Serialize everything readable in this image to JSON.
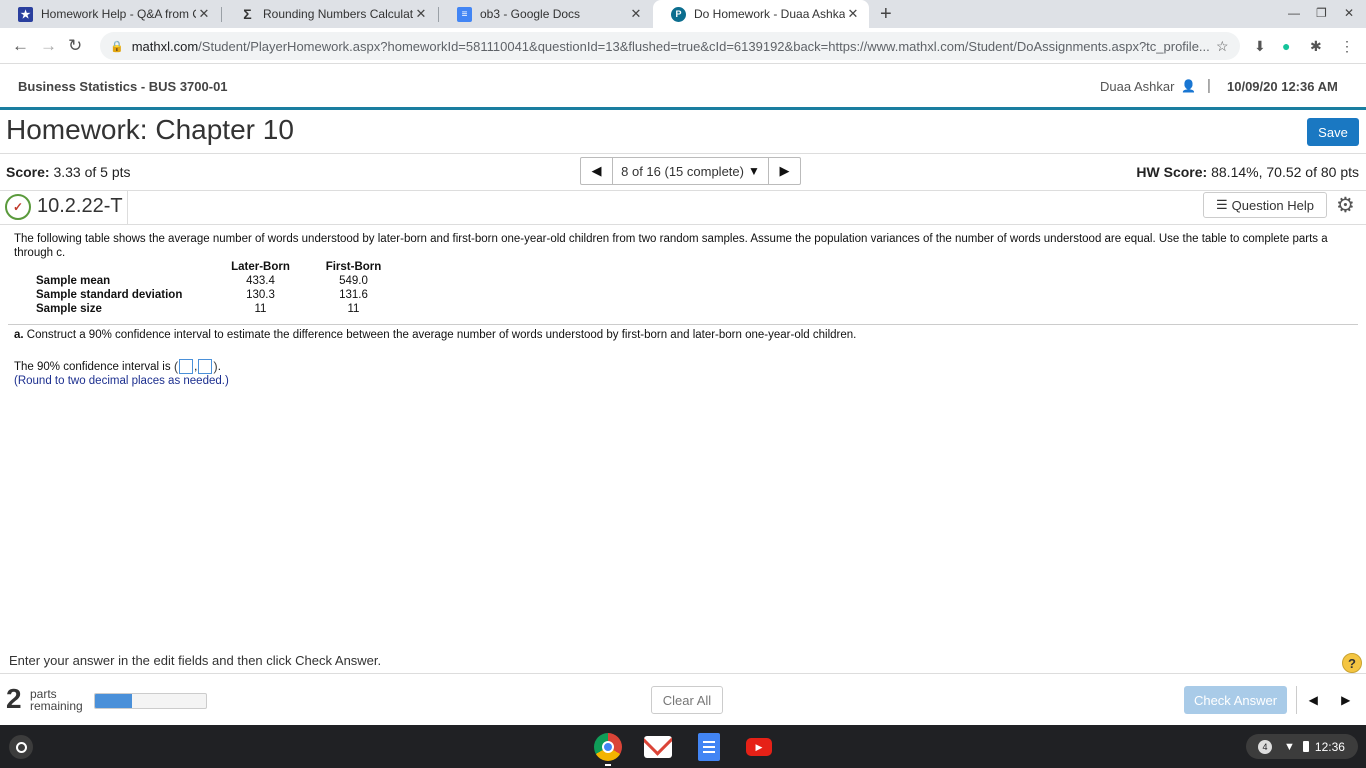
{
  "browser": {
    "tabs": [
      {
        "title": "Homework Help - Q&A from Onli",
        "icon": "star-shield-icon",
        "active": false
      },
      {
        "title": "Rounding Numbers Calculator",
        "icon": "sigma-icon",
        "active": false
      },
      {
        "title": "ob3 - Google Docs",
        "icon": "docs-icon",
        "active": false
      },
      {
        "title": "Do Homework - Duaa Ashkar",
        "icon": "pearson-icon",
        "active": true
      }
    ],
    "new_tab": "+",
    "url_host": "mathxl.com",
    "url_rest": "/Student/PlayerHomework.aspx?homeworkId=581110041&questionId=13&flushed=true&cId=6139192&back=https://www.mathxl.com/Student/DoAssignments.aspx?tc_profile..."
  },
  "header": {
    "course": "Business Statistics - BUS 3700-01",
    "user": "Duaa Ashkar",
    "separator": "|",
    "datetime": "10/09/20 12:36 AM"
  },
  "homework": {
    "title": "Homework: Chapter 10",
    "save_label": "Save",
    "score_label": "Score:",
    "score_value": "3.33 of 5 pts",
    "question_nav": "8 of 16 (15 complete)",
    "hw_score_label": "HW Score:",
    "hw_score_value": "88.14%, 70.52 of 80 pts",
    "question_id": "10.2.22-T",
    "question_help": "Question Help"
  },
  "question": {
    "text": "The following table shows the average number of words understood by later-born and first-born one-year-old children from two random samples. Assume the population variances of the number of words understood are equal. Use the table to complete parts a through c.",
    "table": {
      "columns": [
        "Later-Born",
        "First-Born"
      ],
      "rows": [
        {
          "label": "Sample mean",
          "values": [
            "433.4",
            "549.0"
          ]
        },
        {
          "label": "Sample standard deviation",
          "values": [
            "130.3",
            "131.6"
          ]
        },
        {
          "label": "Sample size",
          "values": [
            "11",
            "11"
          ]
        }
      ]
    },
    "part_a_label": "a.",
    "part_a_text": "Construct a 90% confidence interval to estimate the difference between the average number of words understood by first-born and later-born one-year-old children.",
    "ci_prefix": "The 90% confidence interval is",
    "ci_open": "(",
    "ci_comma": ",",
    "ci_close": ")",
    "ci_end": ".",
    "round_note": "(Round to two decimal places as needed.)"
  },
  "footer": {
    "instruction": "Enter your answer in the edit fields and then click Check Answer.",
    "help": "?",
    "parts_num": "2",
    "parts_label1": "parts",
    "parts_label2": "remaining",
    "progress_fraction": 0.33,
    "clear_all": "Clear All",
    "check_answer": "Check Answer"
  },
  "shelf": {
    "notifications": "4",
    "time": "12:36"
  }
}
